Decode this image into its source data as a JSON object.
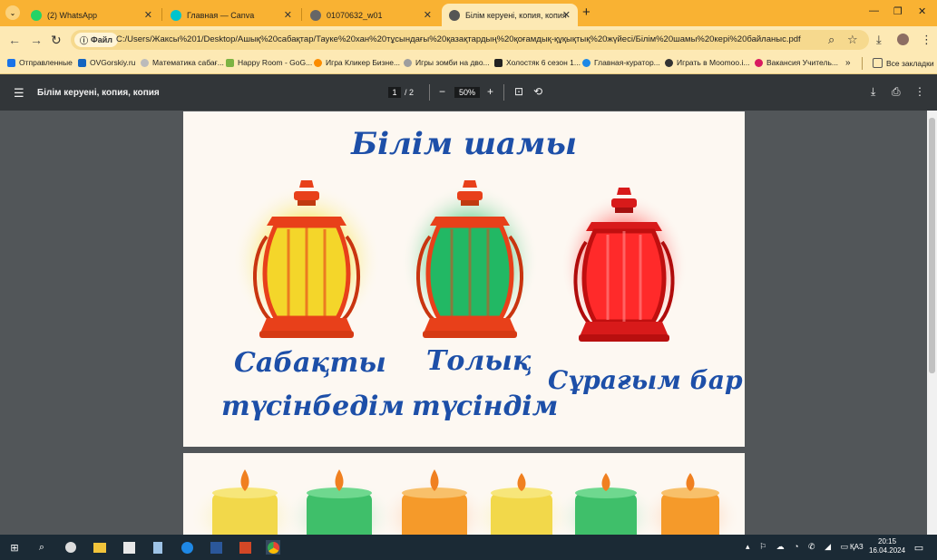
{
  "tabs": [
    {
      "label": "(2) WhatsApp",
      "color": "#25d366"
    },
    {
      "label": "Главная — Canva",
      "color": "#00c4cc"
    },
    {
      "label": "01070632_w01",
      "color": "#555555"
    },
    {
      "label": "Білім керуені, копия, копия",
      "color": "#555555"
    }
  ],
  "toolbar": {
    "file_chip": "Файл",
    "url": "C:/Users/Жаксы%201/Desktop/Ашық%20сабақтар/Тауке%20хан%20тұсындағы%20қазақтардың%20қоғамдық-құқықтық%20жүйесі/Білім%20шамы%20кері%20байланыс.pdf"
  },
  "bookmarks": [
    {
      "label": "Отправленные",
      "color": "#1a73e8"
    },
    {
      "label": "OVGorskiy.ru",
      "color": "#1565c0"
    },
    {
      "label": "Математика сабағ...",
      "color": "#bbbbbb"
    },
    {
      "label": "Happy Room - GoG...",
      "color": "#7cb342"
    },
    {
      "label": "Игра Кликер Бизне...",
      "color": "#fb8c00"
    },
    {
      "label": "Игры зомби на дво...",
      "color": "#9e9e9e"
    },
    {
      "label": "Холостяк 6 сезон 1...",
      "color": "#222222"
    },
    {
      "label": "Главная-куратор...",
      "color": "#1e88e5"
    },
    {
      "label": "Играть в Moomoo.i...",
      "color": "#333333"
    },
    {
      "label": "Вакансия Учитель...",
      "color": "#d81b60"
    },
    {
      "label": "Все закладки",
      "color": "#555555"
    }
  ],
  "pdf": {
    "title": "Білім керуені, копия, копия",
    "page": "1",
    "of_pages": "/ 2",
    "zoom": "50%"
  },
  "page1": {
    "title": "Білім шамы",
    "label1_line1": "Сабақты",
    "label1_line2": "түсінбедім",
    "label2_line1": "Толық",
    "label2_line2": "түсіндім",
    "label3": "Сұрағым бар"
  },
  "colors": {
    "yellow": "#f5e63a",
    "green": "#2fbf6a",
    "red": "#ff2020",
    "title_blue": "#1d4fa8"
  },
  "system": {
    "lang": "ҚАЗ",
    "time": "20:15",
    "date": "16.04.2024"
  }
}
